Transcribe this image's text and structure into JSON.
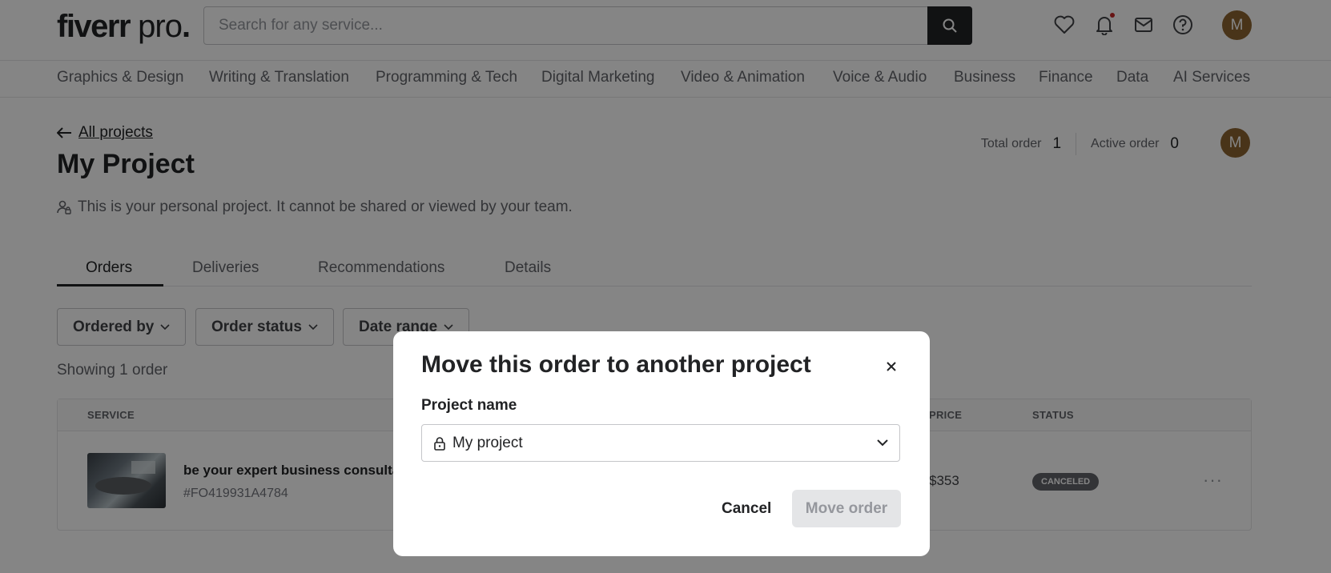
{
  "header": {
    "logo_main": "fiverr",
    "logo_suffix": " pro",
    "logo_dot": ".",
    "search_placeholder": "Search for any service...",
    "avatar_initial": "M",
    "icons": [
      "search-icon",
      "heart-icon",
      "bell-icon",
      "mail-icon",
      "help-icon"
    ]
  },
  "categories": [
    "Graphics & Design",
    "Writing & Translation",
    "Programming & Tech",
    "Digital Marketing",
    "Video & Animation",
    "Voice & Audio",
    "Business",
    "Finance",
    "Data",
    "AI Services"
  ],
  "page": {
    "back_label": "All projects",
    "title": "My Project",
    "subtitle": "This is your personal project. It cannot be shared or viewed by your team.",
    "total_order_label": "Total order",
    "total_order_value": "1",
    "active_order_label": "Active order",
    "active_order_value": "0",
    "owner_initial": "M"
  },
  "tabs": [
    "Orders",
    "Deliveries",
    "Recommendations",
    "Details"
  ],
  "active_tab": "Orders",
  "filters": [
    "Ordered by",
    "Order status",
    "Date range"
  ],
  "showing": "Showing 1 order",
  "table": {
    "headers": {
      "service": "SERVICE",
      "price": "PRICE",
      "status": "STATUS"
    },
    "rows": [
      {
        "service": "be your expert business consultan",
        "order_id": "#FO419931A4784",
        "price": "$353",
        "status": "CANCELED"
      }
    ]
  },
  "modal": {
    "title": "Move this order to another project",
    "field_label": "Project name",
    "selected_project": "My project",
    "cancel_label": "Cancel",
    "move_label": "Move order"
  },
  "colors": {
    "accent_dark": "#222325",
    "avatar_bg": "#8d6430",
    "badge_bg": "#62646a",
    "disabled_btn_bg": "#e4e5e7",
    "notification_dot": "#c62828"
  }
}
